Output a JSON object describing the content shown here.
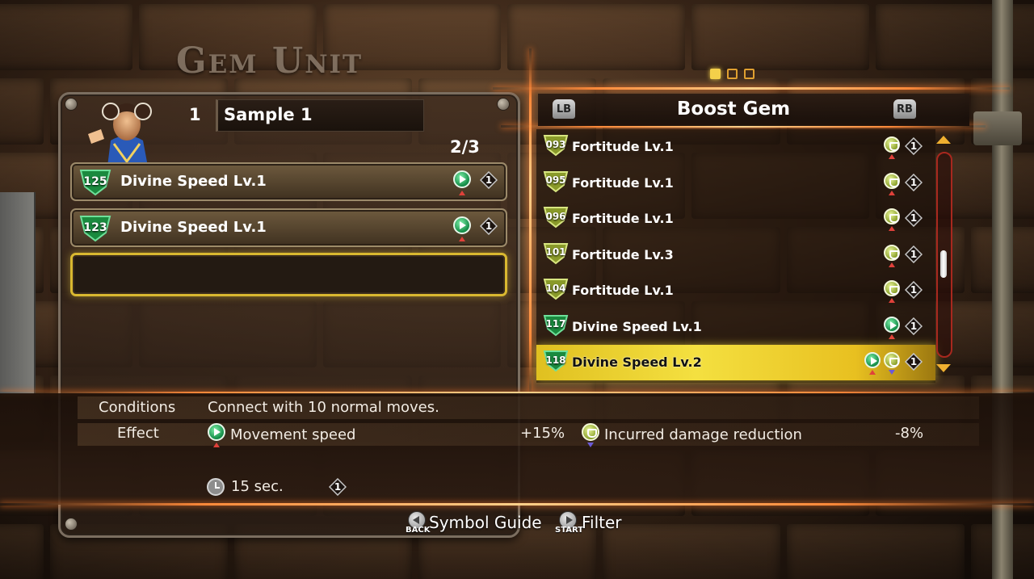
{
  "screen_title": "Gem Unit",
  "unit": {
    "number": "1",
    "name": "Sample 1",
    "slot_count": "2/3",
    "slots": [
      {
        "id": "125",
        "name": "Divine Speed Lv.1",
        "icon": "speed-icon",
        "count": "1"
      },
      {
        "id": "123",
        "name": "Divine Speed Lv.1",
        "icon": "speed-icon",
        "count": "1"
      }
    ]
  },
  "list": {
    "title": "Boost Gem",
    "lb": "LB",
    "rb": "RB",
    "page_count": 3,
    "active_page": 1,
    "items": [
      {
        "id": "093",
        "name": "Fortitude Lv.1",
        "icons": [
          "defense-icon"
        ],
        "count": "1",
        "color": "olive"
      },
      {
        "id": "095",
        "name": "Fortitude Lv.1",
        "icons": [
          "defense-icon"
        ],
        "count": "1",
        "color": "olive"
      },
      {
        "id": "096",
        "name": "Fortitude Lv.1",
        "icons": [
          "defense-icon"
        ],
        "count": "1",
        "color": "olive"
      },
      {
        "id": "101",
        "name": "Fortitude Lv.3",
        "icons": [
          "defense-icon"
        ],
        "count": "1",
        "color": "olive"
      },
      {
        "id": "104",
        "name": "Fortitude Lv.1",
        "icons": [
          "defense-icon"
        ],
        "count": "1",
        "color": "olive"
      },
      {
        "id": "117",
        "name": "Divine Speed Lv.1",
        "icons": [
          "speed-icon"
        ],
        "count": "1",
        "color": "green"
      },
      {
        "id": "118",
        "name": "Divine Speed Lv.2",
        "icons": [
          "speed-icon",
          "defense-icon"
        ],
        "count": "1",
        "color": "green",
        "selected": true
      }
    ]
  },
  "details": {
    "conditions_label": "Conditions",
    "conditions_value": "Connect with 10 normal moves.",
    "effect_label": "Effect",
    "effect1_name": "Movement speed",
    "effect1_value": "+15%",
    "effect2_name": "Incurred damage reduction",
    "effect2_value": "-8%",
    "duration": "15 sec.",
    "cost": "1"
  },
  "footer": {
    "back_caption": "BACK",
    "symbol_guide": "Symbol Guide",
    "start_caption": "START",
    "filter": "Filter"
  },
  "colors": {
    "accent_orange": "#ff8a3a",
    "selection_yellow": "#f4e040",
    "gem_green": "#1a8a3e",
    "gem_olive": "#8a9a2a"
  }
}
